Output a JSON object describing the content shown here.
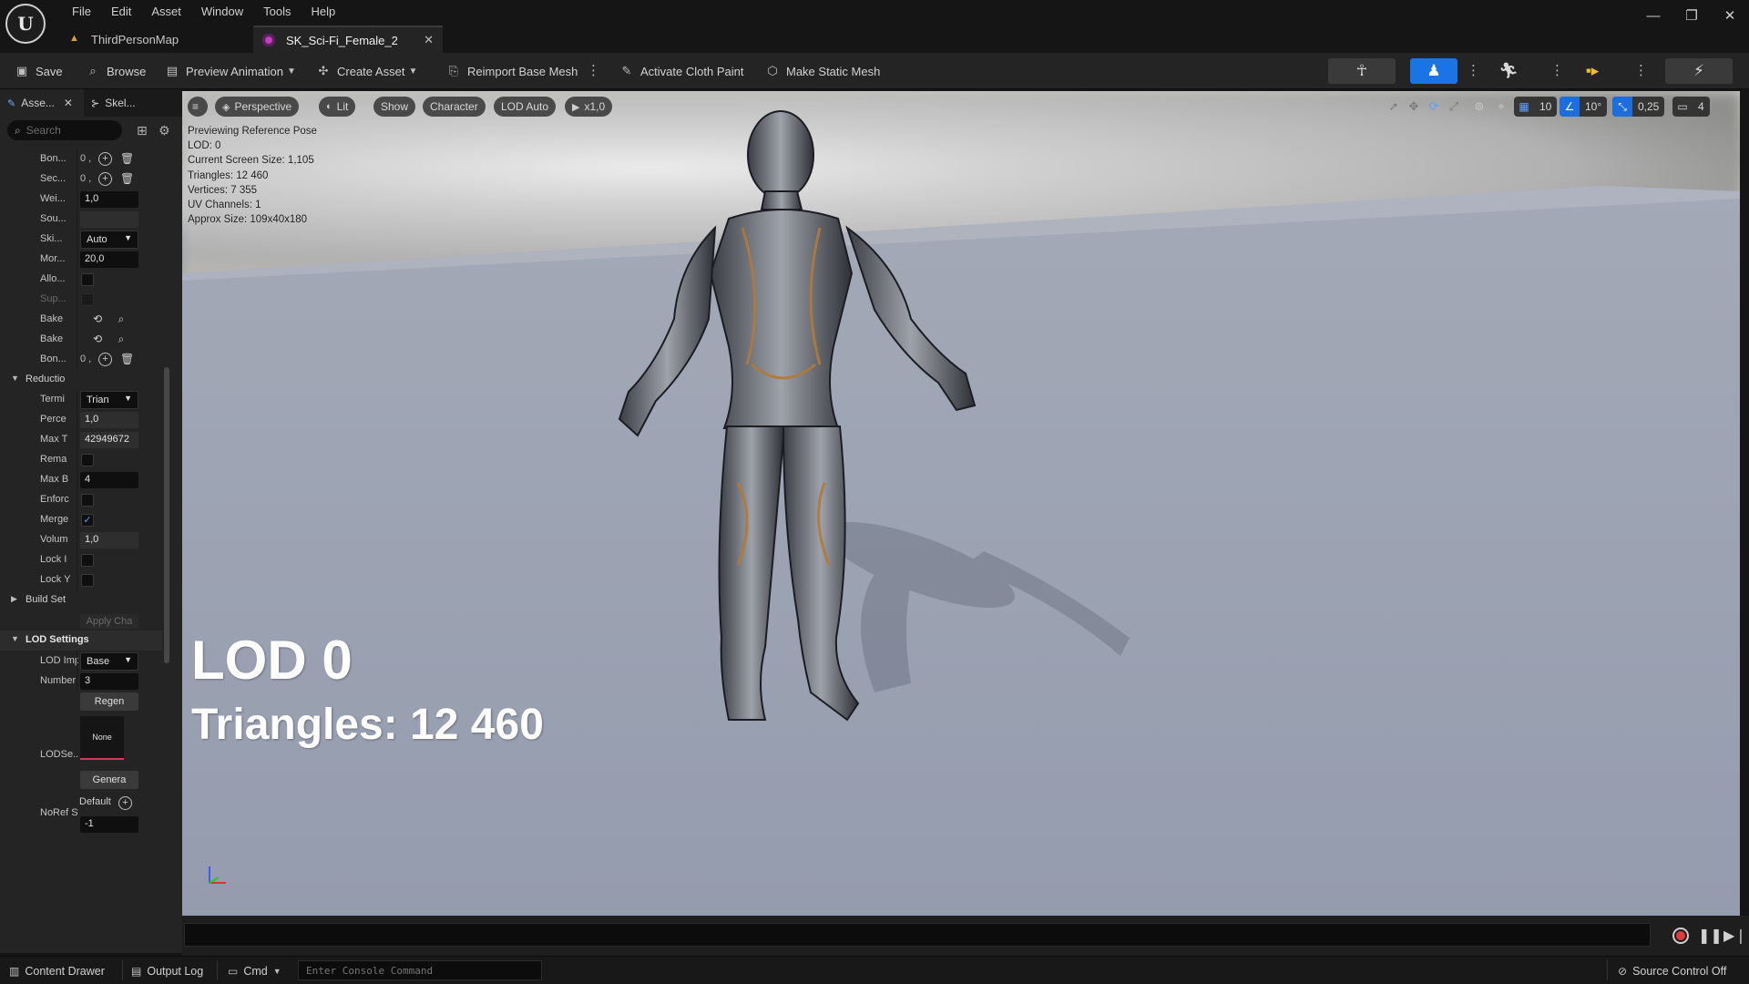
{
  "menubar": {
    "logo": "U",
    "items": [
      "File",
      "Edit",
      "Asset",
      "Window",
      "Tools",
      "Help"
    ],
    "window_controls": {
      "minimize": "—",
      "restore": "❐",
      "close": "✕"
    }
  },
  "tabs": [
    {
      "label": "ThirdPersonMap",
      "icon": "level-map-icon"
    },
    {
      "label": "SK_Sci-Fi_Female_2",
      "icon": "skeletal-mesh-icon",
      "close": "✕"
    }
  ],
  "toolbar": {
    "save": "Save",
    "browse": "Browse",
    "preview_animation": "Preview Animation",
    "create_asset": "Create Asset",
    "reimport_base_mesh": "Reimport Base Mesh",
    "activate_cloth_paint": "Activate Cloth Paint",
    "make_static_mesh": "Make Static Mesh",
    "accent_color": "#1a74e6"
  },
  "left_panel": {
    "tab_asset": "Asse...",
    "tab_close": "✕",
    "tab_skeleton": "Skel...",
    "search_placeholder": "Search",
    "rows": {
      "bon1": {
        "label": "Bon...",
        "value": "0 ,"
      },
      "sec": {
        "label": "Sec...",
        "value": "0 ,"
      },
      "wei": {
        "label": "Wei...",
        "value": "1,0"
      },
      "sou": {
        "label": "Sou..."
      },
      "ski": {
        "label": "Ski...",
        "value": "Auto"
      },
      "mor": {
        "label": "Mor...",
        "value": "20,0"
      },
      "allo": {
        "label": "Allo..."
      },
      "sup": {
        "label": "Sup..."
      },
      "bake1": {
        "label": "Bake"
      },
      "bake2": {
        "label": "Bake"
      },
      "bon2": {
        "label": "Bon...",
        "value": "0 ,"
      },
      "reduction": {
        "label": "Reductio"
      },
      "termi": {
        "label": "Termi",
        "value": "Trian"
      },
      "perce": {
        "label": "Perce",
        "value": "1,0"
      },
      "maxt": {
        "label": "Max T",
        "value": "42949672"
      },
      "rema": {
        "label": "Rema"
      },
      "maxb": {
        "label": "Max B",
        "value": "4"
      },
      "enfor": {
        "label": "Enforc"
      },
      "merge": {
        "label": "Merge",
        "checked": "✓"
      },
      "volum": {
        "label": "Volum",
        "value": "1,0"
      },
      "lock1": {
        "label": "Lock I"
      },
      "lock2": {
        "label": "Lock Y"
      },
      "build_set": {
        "label": "Build Set"
      },
      "apply_cha": {
        "label": "Apply Cha"
      },
      "lod_settings": {
        "label": "LOD Settings"
      },
      "lod_imp": {
        "label": "LOD Impo",
        "value": "Base"
      },
      "number": {
        "label": "Number o",
        "value": "3"
      },
      "regen": {
        "label": "Regen"
      },
      "lodse": {
        "label": "LODSe...",
        "thumb": "None",
        "generate": "Genera"
      },
      "noref": {
        "label": "NoRef St",
        "default": "Default",
        "value": "-1"
      }
    }
  },
  "viewport": {
    "menu_icon": "≡",
    "perspective": "Perspective",
    "lit": "Lit",
    "show": "Show",
    "character": "Character",
    "lod_auto": "LOD Auto",
    "speed": "x1,0",
    "grid_value": "10",
    "angle_value": "10°",
    "scale_value": "0,25",
    "camera_value": "4",
    "stats": [
      "Previewing Reference Pose",
      "LOD: 0",
      "Current Screen Size: 1,105",
      "Triangles: 12 460",
      "Vertices: 7 355",
      "UV Channels: 1",
      "Approx Size: 109x40x180"
    ],
    "lod_big": "LOD 0",
    "tris_big": "Triangles: 12 460"
  },
  "statusbar": {
    "content_drawer": "Content Drawer",
    "output_log": "Output Log",
    "cmd": "Cmd",
    "console_placeholder": "Enter Console Command",
    "source_control": "Source Control Off"
  }
}
